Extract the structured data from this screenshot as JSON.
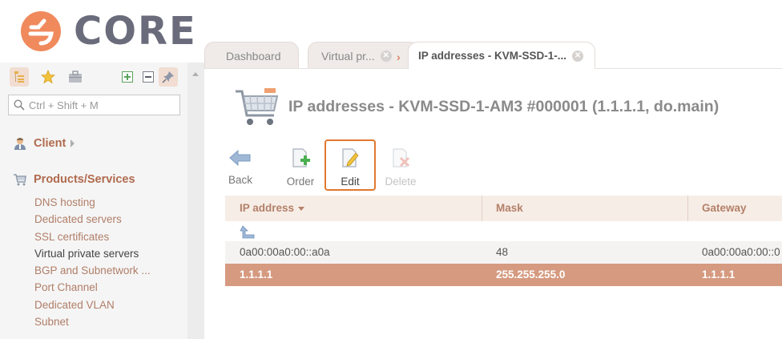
{
  "brand": {
    "name": "CORE",
    "accent_color": "#f08a5d",
    "text_color": "#6a6c7c"
  },
  "sidebar": {
    "tools": [
      {
        "icon": "tree-icon",
        "active": true
      },
      {
        "icon": "star-icon"
      },
      {
        "icon": "briefcase-icon"
      },
      {
        "icon": "expand-all-icon"
      },
      {
        "icon": "collapse-all-icon"
      },
      {
        "icon": "pin-icon",
        "active": true
      }
    ],
    "search": {
      "placeholder": "Ctrl + Shift + M"
    },
    "groups": [
      {
        "label": "Client",
        "icon": "client-icon"
      },
      {
        "label": "Products/Services",
        "icon": "cart-icon"
      }
    ],
    "items": [
      {
        "label": "DNS hosting"
      },
      {
        "label": "Dedicated servers"
      },
      {
        "label": "SSL certificates"
      },
      {
        "label": "Virtual private servers",
        "current": true
      },
      {
        "label": "BGP and Subnetwork ..."
      },
      {
        "label": "Port Channel"
      },
      {
        "label": "Dedicated VLAN"
      },
      {
        "label": "Subnet"
      }
    ]
  },
  "tabs": [
    {
      "label": "Dashboard"
    },
    {
      "label": "Virtual pr...",
      "closable": true
    },
    {
      "label": "IP addresses - KVM-SSD-1-...",
      "closable": true,
      "active": true
    }
  ],
  "page": {
    "title": "IP addresses - KVM-SSD-1-AM3 #000001 (1.1.1.1, do.main)",
    "icon": "shopping-cart-icon"
  },
  "toolbar": {
    "back": "Back",
    "order": "Order",
    "edit": "Edit",
    "delete": "Delete"
  },
  "table": {
    "columns": [
      "IP address",
      "Mask",
      "Gateway"
    ],
    "sorted_column": "IP address",
    "rows": [
      [
        "0a00:00a0:00::a0a",
        "48",
        "0a00:00a0:00::0"
      ],
      [
        "1.1.1.1",
        "255.255.255.0",
        "1.1.1.1"
      ]
    ],
    "selected_row": 1,
    "selected_row_color": "#d59a80"
  }
}
